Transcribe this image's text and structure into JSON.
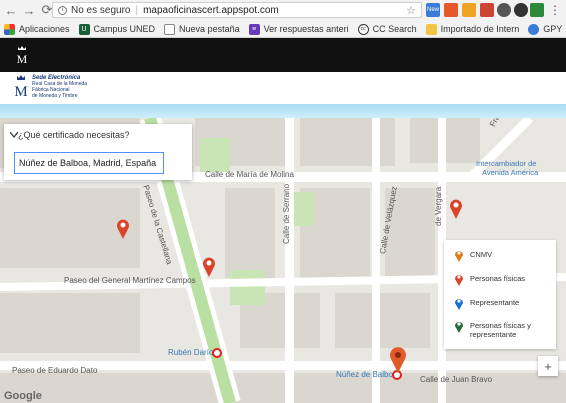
{
  "browser": {
    "security_label": "No es seguro",
    "url": "mapaoficinascert.appspot.com",
    "extension_new": "New",
    "bookmarks": [
      {
        "label": "Aplicaciones"
      },
      {
        "label": "Campus UNED"
      },
      {
        "label": "Nueva pestaña"
      },
      {
        "label": "Ver respuestas anteri"
      },
      {
        "label": "CC Search"
      },
      {
        "label": "Importado de Intern"
      },
      {
        "label": "GPY"
      }
    ]
  },
  "site": {
    "logo_title": "Sede Electrónica",
    "logo_line1": "Real Casa de la Moneda",
    "logo_line2": "Fábrica Nacional",
    "logo_line3": "de Moneda y Timbre"
  },
  "search": {
    "question": "¿Qué certificado necesitas?",
    "value": "Núñez de Balboa, Madrid, España"
  },
  "map_labels": {
    "calle_maria_molina": "Calle de María de Molina",
    "intercambiador": "Intercambiador de",
    "avenida_america": "Avenida América",
    "francisco_silvela": "Francisco Silvela",
    "paseo_castellana": "Paseo de la Castellana",
    "calle_serrano": "Calle de Serrano",
    "calle_velazquez": "Calle de Velázquez",
    "calle_vergara": "de Vergara",
    "paseo_martinez_campos": "Paseo del General Martínez Campos",
    "ruben_dario": "Rubén Darío",
    "paseo_eduardo_dato": "Paseo de Eduardo Dato",
    "nunez_balboa": "Núñez de Balboa",
    "calle_juan_bravo": "Calle de Juan Bravo",
    "google": "Google"
  },
  "legend": [
    {
      "label": "CNMV",
      "color": "#e07b1a"
    },
    {
      "label": "Personas físicas",
      "color": "#d9442b"
    },
    {
      "label": "Representante",
      "color": "#1e6fd1"
    },
    {
      "label": "Personas físicas y representante",
      "color": "#2d6b3a"
    }
  ],
  "zoom_in": "+"
}
